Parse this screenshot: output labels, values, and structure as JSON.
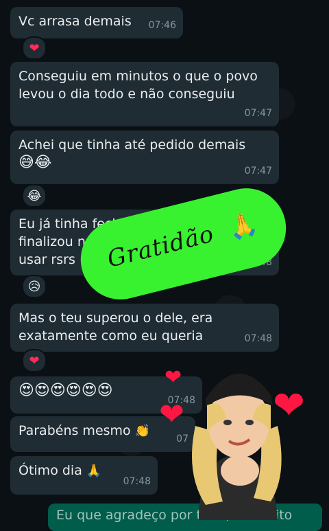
{
  "messages": [
    {
      "text": "Vc arrasa demais",
      "time": "07:46",
      "reaction": "❤"
    },
    {
      "text": "Conseguiu em minutos o que o povo levou o dia todo e não conseguiu",
      "time": "07:47"
    },
    {
      "text": "Achei que tinha até pedido demais",
      "emoji": "😅😂",
      "time": "07:47",
      "reaction": "😂"
    },
    {
      "text": "Eu já tinha fechado c",
      "line2": "finalizou n",
      "line3": "usar rsrs",
      "time": "07:48",
      "reaction": "😥"
    },
    {
      "text": "Mas o teu superou o dele, era exatamente como eu queria",
      "time": "07:48",
      "reaction": "❤"
    },
    {
      "emoji": "😍😍😍😍😍😍",
      "time": "07:48"
    },
    {
      "text": "Parabéns mesmo",
      "emoji": "👏",
      "time": "07"
    },
    {
      "text": "Ótimo dia",
      "emoji": "🙏",
      "time": "07:48"
    }
  ],
  "sent_message": {
    "text": "Eu que agradeço por tudo, foi muito"
  },
  "sticker": {
    "text": "Gratidão",
    "emoji": "🙏"
  },
  "colors": {
    "bubble": "#202c33",
    "sent": "#005c4b",
    "sticker": "#38f22f",
    "heart": "#ff2d55"
  }
}
